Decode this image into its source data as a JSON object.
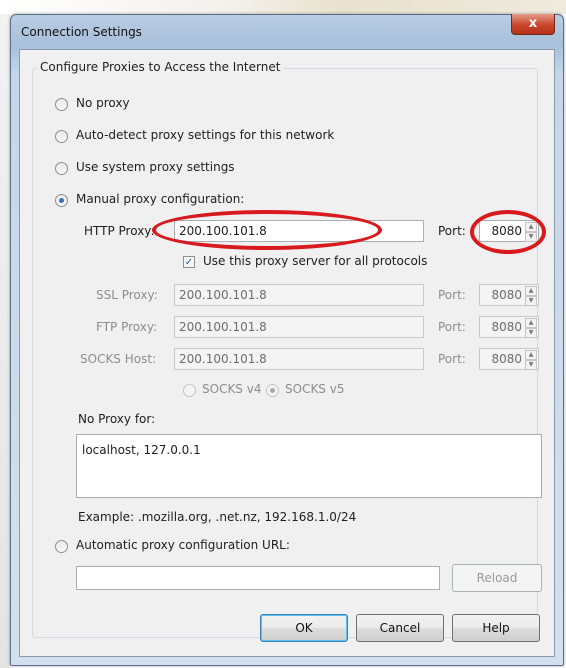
{
  "window": {
    "title": "Connection Settings",
    "close_glyph": "x"
  },
  "group": {
    "title": "Configure Proxies to Access the Internet"
  },
  "options": {
    "no_proxy": "No proxy",
    "auto_detect": "Auto-detect proxy settings for this network",
    "system": "Use system proxy settings",
    "manual": "Manual proxy configuration:",
    "auto_url": "Automatic proxy configuration URL:",
    "selected": "manual"
  },
  "http": {
    "label": "HTTP Proxy:",
    "value": "200.100.101.8",
    "port_label": "Port:",
    "port": "8080"
  },
  "use_for_all": {
    "label": "Use this proxy server for all protocols",
    "checked": true
  },
  "ssl": {
    "label": "SSL Proxy:",
    "value": "200.100.101.8",
    "port_label": "Port:",
    "port": "8080"
  },
  "ftp": {
    "label": "FTP Proxy:",
    "value": "200.100.101.8",
    "port_label": "Port:",
    "port": "8080"
  },
  "socks": {
    "label": "SOCKS Host:",
    "value": "200.100.101.8",
    "port_label": "Port:",
    "port": "8080",
    "v4_label": "SOCKS v4",
    "v5_label": "SOCKS v5",
    "selected": "v5"
  },
  "no_proxy_for": {
    "label": "No Proxy for:",
    "value": "localhost, 127.0.0.1",
    "example": "Example: .mozilla.org, .net.nz, 192.168.1.0/24"
  },
  "auto_url": {
    "value": "",
    "reload_label": "Reload"
  },
  "buttons": {
    "ok": "OK",
    "cancel": "Cancel",
    "help": "Help"
  },
  "annotation_color": "#d8191d"
}
